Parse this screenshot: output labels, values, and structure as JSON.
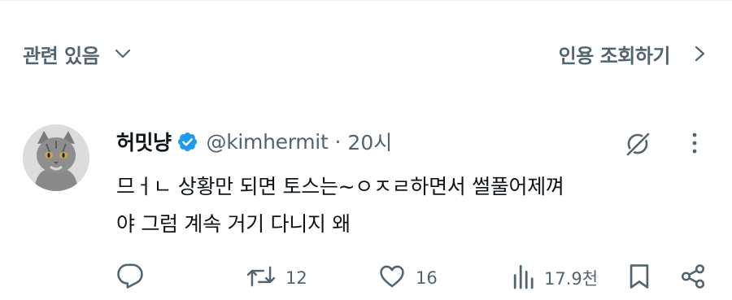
{
  "header": {
    "related_label": "관련 있음",
    "quotes_label": "인용 조회하기"
  },
  "tweet": {
    "display_name": "허밋냥",
    "handle": "@kimhermit",
    "separator": "·",
    "time": "20시",
    "text_line1": "므ㅓㄴ 상황만 되면 토스는~ㅇㅈㄹ하면서 썰풀어제껴",
    "text_line2": "야 그럼 계속 거기 다니지 왜"
  },
  "actions": {
    "retweet_count": "12",
    "like_count": "16",
    "views_count": "17.9천"
  },
  "colors": {
    "verified": "#1d9bf0",
    "muted": "#536471",
    "text": "#0f1419"
  }
}
